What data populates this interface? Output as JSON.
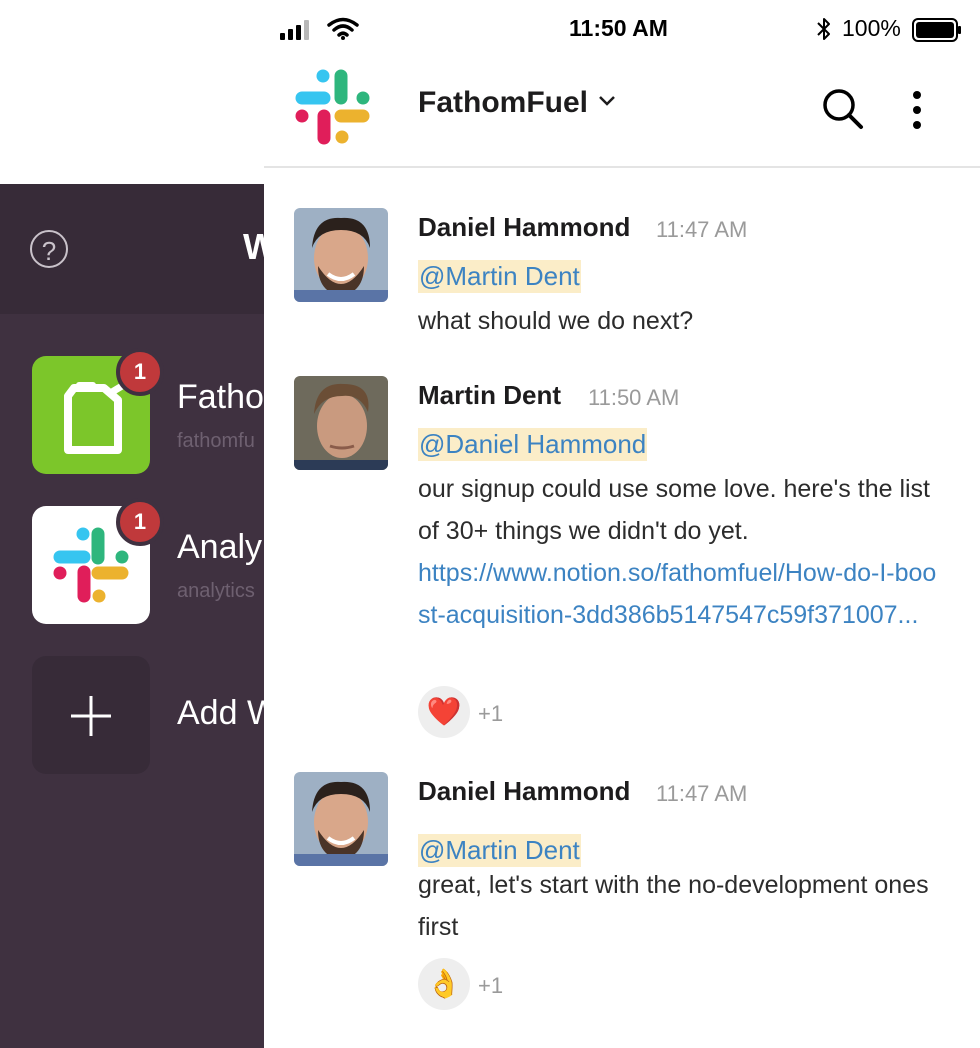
{
  "status_bar": {
    "time": "11:50 AM",
    "battery_percent": "100%",
    "icons": [
      "signal-icon",
      "wifi-icon",
      "bluetooth-icon",
      "battery-icon"
    ]
  },
  "drawer": {
    "title": "W",
    "help_icon": "question-icon",
    "help_glyph": "?",
    "workspaces": [
      {
        "name": "Fatho",
        "domain": "fathomfu",
        "badge": "1",
        "icon": "fuel-can-icon",
        "tile_color": "#7cc62a"
      },
      {
        "name": "Analy",
        "domain": "analytics",
        "badge": "1",
        "icon": "slack-logo-icon",
        "tile_color": "#ffffff"
      },
      {
        "name": "Add W",
        "icon": "plus-icon",
        "tile_color": "#372b38"
      }
    ]
  },
  "header": {
    "workspace_name": "FathomFuel",
    "icons": [
      "slack-logo-icon",
      "chevron-down-icon",
      "search-icon",
      "more-vertical-icon"
    ]
  },
  "messages": [
    {
      "author": "Daniel Hammond",
      "time": "11:47 AM",
      "mention": "@Martin Dent",
      "text": "what should we do next?"
    },
    {
      "author": "Martin Dent",
      "time": "11:50 AM",
      "mention": "@Daniel Hammond",
      "text": "our signup could use some love. here's the list of 30+ things we didn't do yet.",
      "link": "https://www.notion.so/fathomfuel/How-do-I-boost-acquisition-3dd386b5147547c59f371007...",
      "reaction": {
        "emoji": "❤️",
        "count": "+1"
      }
    },
    {
      "author": "Daniel Hammond",
      "time": "11:47 AM",
      "mention": "@Martin Dent",
      "text": "great, let's start with the no-development ones first",
      "reaction": {
        "emoji": "👌",
        "count": "+1"
      }
    }
  ],
  "colors": {
    "drawer_bg": "#3f3140",
    "badge": "#c0393b",
    "mention_bg": "#fbedc8",
    "link": "#3c83c2",
    "slack_blue": "#36c5f0",
    "slack_green": "#2eb67d",
    "slack_red": "#e01e5a",
    "slack_yellow": "#ecb22e"
  }
}
